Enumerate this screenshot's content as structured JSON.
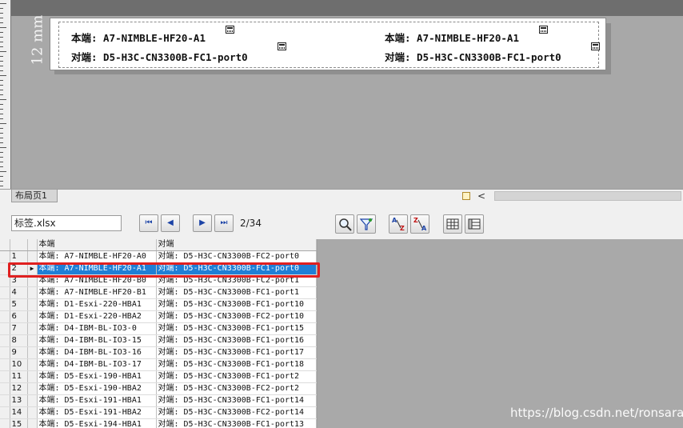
{
  "design": {
    "unit_label": "12 mm",
    "label_fields": [
      {
        "prefix": "本端",
        "value": "A7-NIMBLE-HF20-A1"
      },
      {
        "prefix": "对端",
        "value": "D5-H3C-CN3300B-FC1-port0"
      },
      {
        "prefix": "本端",
        "value": "A7-NIMBLE-HF20-A1"
      },
      {
        "prefix": "对端",
        "value": "D5-H3C-CN3300B-FC1-port0"
      }
    ],
    "label_lines": [
      "本端: A7-NIMBLE-HF20-A1",
      "对端: D5-H3C-CN3300B-FC1-port0",
      "本端: A7-NIMBLE-HF20-A1",
      "对端: D5-H3C-CN3300B-FC1-port0"
    ]
  },
  "tabs": {
    "page_tab": "布局页1"
  },
  "navigator": {
    "file_name": "标签.xlsx",
    "page_counter": "2/34",
    "buttons": {
      "first": "⏮",
      "prev": "◀",
      "next": "▶",
      "last": "⏭"
    }
  },
  "grid": {
    "columns": [
      "本端",
      "对端"
    ],
    "selected_row": 2,
    "rows": [
      {
        "n": "1",
        "a": "本端: A7-NIMBLE-HF20-A0",
        "b": "对端: D5-H3C-CN3300B-FC2-port0"
      },
      {
        "n": "2",
        "a": "本端: A7-NIMBLE-HF20-A1",
        "b": "对端: D5-H3C-CN3300B-FC1-port0"
      },
      {
        "n": "3",
        "a": "本端: A7-NIMBLE-HF20-B0",
        "b": "对端: D5-H3C-CN3300B-FC2-port1"
      },
      {
        "n": "4",
        "a": "本端: A7-NIMBLE-HF20-B1",
        "b": "对端: D5-H3C-CN3300B-FC1-port1"
      },
      {
        "n": "5",
        "a": "本端: D1-Esxi-220-HBA1",
        "b": "对端: D5-H3C-CN3300B-FC1-port10"
      },
      {
        "n": "6",
        "a": "本端: D1-Esxi-220-HBA2",
        "b": "对端: D5-H3C-CN3300B-FC2-port10"
      },
      {
        "n": "7",
        "a": "本端: D4-IBM-BL-IO3-0",
        "b": "对端: D5-H3C-CN3300B-FC1-port15"
      },
      {
        "n": "8",
        "a": "本端: D4-IBM-BL-IO3-15",
        "b": "对端: D5-H3C-CN3300B-FC1-port16"
      },
      {
        "n": "9",
        "a": "本端: D4-IBM-BL-IO3-16",
        "b": "对端: D5-H3C-CN3300B-FC1-port17"
      },
      {
        "n": "10",
        "a": "本端: D4-IBM-BL-IO3-17",
        "b": "对端: D5-H3C-CN3300B-FC1-port18"
      },
      {
        "n": "11",
        "a": "本端: D5-Esxi-190-HBA1",
        "b": "对端: D5-H3C-CN3300B-FC1-port2"
      },
      {
        "n": "12",
        "a": "本端: D5-Esxi-190-HBA2",
        "b": "对端: D5-H3C-CN3300B-FC2-port2"
      },
      {
        "n": "13",
        "a": "本端: D5-Esxi-191-HBA1",
        "b": "对端: D5-H3C-CN3300B-FC1-port14"
      },
      {
        "n": "14",
        "a": "本端: D5-Esxi-191-HBA2",
        "b": "对端: D5-H3C-CN3300B-FC2-port14"
      },
      {
        "n": "15",
        "a": "本端: D5-Esxi-194-HBA1",
        "b": "对端: D5-H3C-CN3300B-FC1-port13"
      }
    ]
  },
  "watermark": "https://blog.csdn.net/ronsarah",
  "colors": {
    "selection": "#1f7fd6",
    "highlight": "#e02020",
    "canvas": "#a8a8a8"
  }
}
